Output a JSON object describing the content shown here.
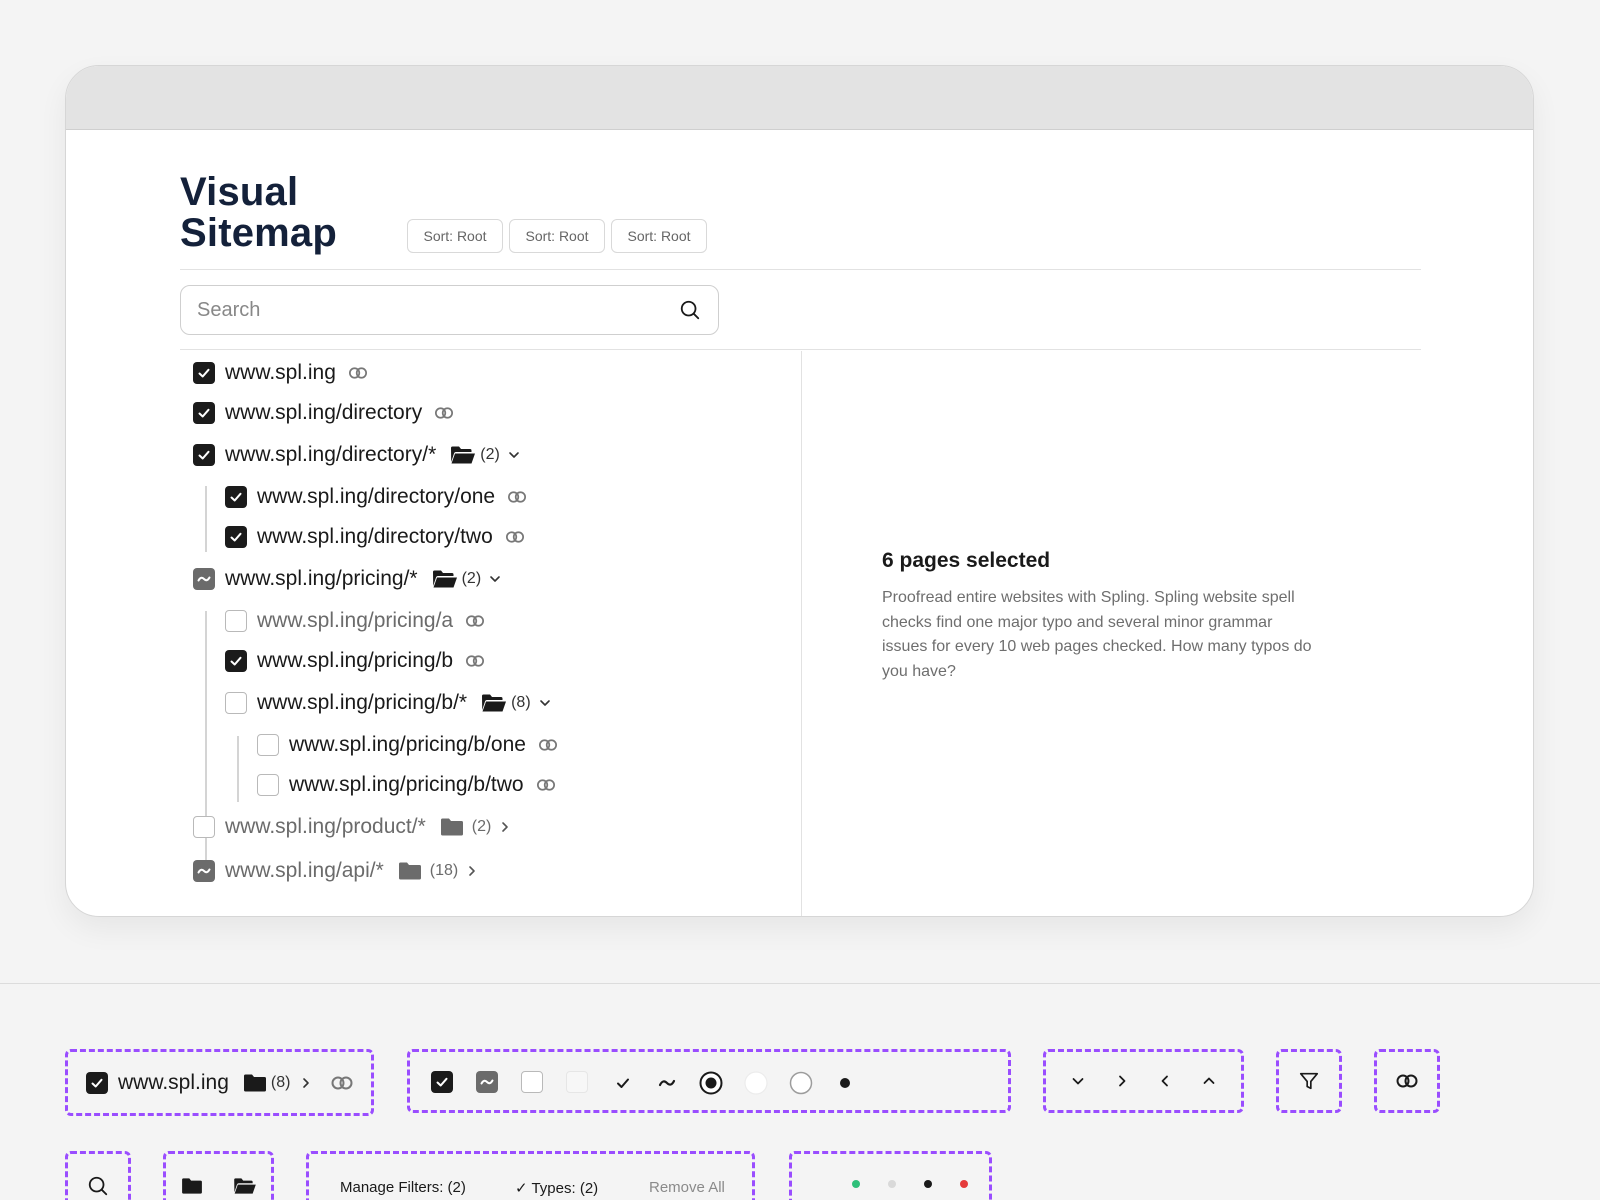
{
  "page": {
    "title_line1": "Visual",
    "title_line2": "Sitemap"
  },
  "sort_buttons": [
    "Sort: Root",
    "Sort: Root",
    "Sort: Root"
  ],
  "search": {
    "placeholder": "Search",
    "value": ""
  },
  "tree": [
    {
      "label": "www.spl.ing",
      "state": "checked",
      "icon": "link-icon"
    },
    {
      "label": "www.spl.ing/directory",
      "state": "checked",
      "icon": "link-icon"
    },
    {
      "label": "www.spl.ing/directory/*",
      "state": "checked",
      "icon": "folder-open-icon",
      "count": "(2)",
      "expanded": true
    },
    {
      "label": "www.spl.ing/directory/one",
      "state": "checked",
      "icon": "link-icon"
    },
    {
      "label": "www.spl.ing/directory/two",
      "state": "checked",
      "icon": "link-icon"
    },
    {
      "label": "www.spl.ing/pricing/*",
      "state": "partial",
      "icon": "folder-open-icon",
      "count": "(2)",
      "expanded": true
    },
    {
      "label": "www.spl.ing/pricing/a",
      "state": "empty",
      "icon": "link-icon"
    },
    {
      "label": "www.spl.ing/pricing/b",
      "state": "checked",
      "icon": "link-icon"
    },
    {
      "label": "www.spl.ing/pricing/b/*",
      "state": "empty",
      "icon": "folder-open-icon",
      "count": "(8)",
      "expanded": true
    },
    {
      "label": "www.spl.ing/pricing/b/one",
      "state": "empty",
      "icon": "link-icon"
    },
    {
      "label": "www.spl.ing/pricing/b/two",
      "state": "empty",
      "icon": "link-icon"
    },
    {
      "label": "www.spl.ing/product/*",
      "state": "empty",
      "icon": "folder-closed-icon",
      "count": "(2)",
      "expanded": false
    },
    {
      "label": "www.spl.ing/api/*",
      "state": "partial",
      "icon": "folder-closed-icon",
      "count": "(18)",
      "expanded": false
    }
  ],
  "selection": {
    "title": "6 pages selected",
    "description": "Proofread entire websites with Spling. Spling website spell checks find one major typo and several minor grammar issues for every 10 web pages checked. How many typos do you have?"
  },
  "components": {
    "sample_row": {
      "label": "www.spl.ing",
      "count": "(8)"
    },
    "checkbox_states": [
      "checked",
      "partial",
      "empty",
      "disabled",
      "check-mark-icon",
      "tilde-icon",
      "radio-selected-icon",
      "radio-empty-icon",
      "radio-empty-bordered-icon",
      "bullet-icon"
    ],
    "chevrons": [
      "chevron-down-icon",
      "chevron-right-icon",
      "chevron-left-icon",
      "chevron-up-icon"
    ],
    "filters": {
      "manage": "Manage Filters: (2)",
      "types": "✓ Types: (2)",
      "remove_all": "Remove All"
    },
    "status_colors": [
      "#2fc07a",
      "#d9d9d9",
      "#1a1a1a",
      "#e53b3b"
    ]
  },
  "colors": {
    "accent_dashed": "#9a4dff",
    "title_navy": "#14213a",
    "checkbox_dark": "#1b1b1b",
    "checkbox_partial": "#6b6b6b"
  }
}
